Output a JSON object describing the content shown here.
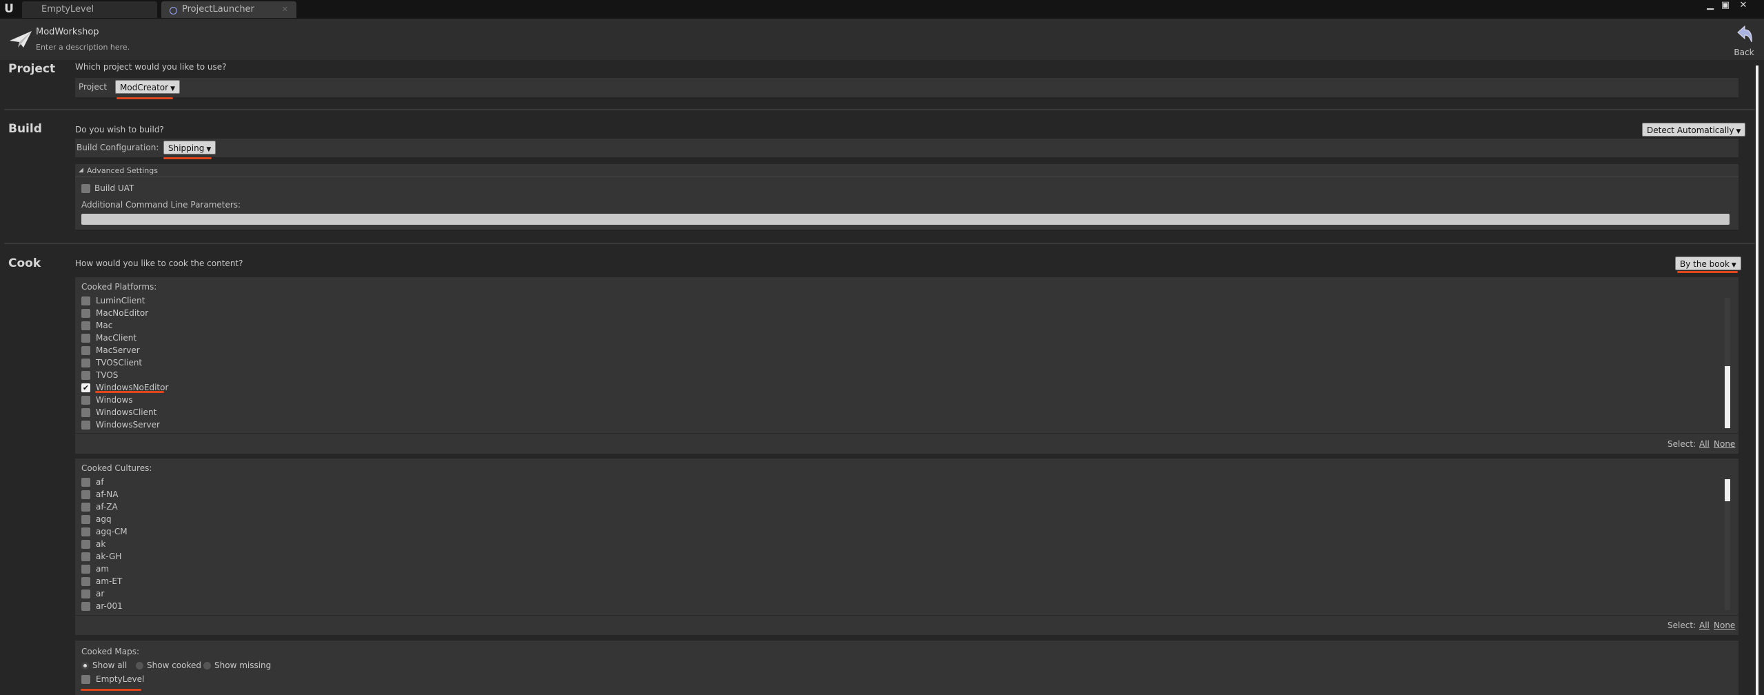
{
  "tabs": [
    {
      "label": "EmptyLevel"
    },
    {
      "label": "ProjectLauncher"
    }
  ],
  "header": {
    "title": "ModWorkshop",
    "description": "Enter a description here.",
    "back_label": "Back"
  },
  "project": {
    "section_title": "Project",
    "question": "Which project would you like to use?",
    "label": "Project",
    "value": "ModCreator"
  },
  "build": {
    "section_title": "Build",
    "question": "Do you wish to build?",
    "mode": "Detect Automatically",
    "config_label": "Build Configuration:",
    "config_value": "Shipping",
    "advanced_label": "Advanced Settings",
    "build_uat_label": "Build UAT",
    "cmdline_label": "Additional Command Line Parameters:",
    "cmdline_value": ""
  },
  "cook": {
    "section_title": "Cook",
    "question": "How would you like to cook the content?",
    "mode": "By the book",
    "platforms_label": "Cooked Platforms:",
    "platforms": [
      {
        "label": "LuminClient",
        "checked": false
      },
      {
        "label": "MacNoEditor",
        "checked": false
      },
      {
        "label": "Mac",
        "checked": false
      },
      {
        "label": "MacClient",
        "checked": false
      },
      {
        "label": "MacServer",
        "checked": false
      },
      {
        "label": "TVOSClient",
        "checked": false
      },
      {
        "label": "TVOS",
        "checked": false
      },
      {
        "label": "WindowsNoEditor",
        "checked": true
      },
      {
        "label": "Windows",
        "checked": false
      },
      {
        "label": "WindowsClient",
        "checked": false
      },
      {
        "label": "WindowsServer",
        "checked": false
      }
    ],
    "cultures_label": "Cooked Cultures:",
    "cultures": [
      {
        "label": "af",
        "checked": false
      },
      {
        "label": "af-NA",
        "checked": false
      },
      {
        "label": "af-ZA",
        "checked": false
      },
      {
        "label": "agq",
        "checked": false
      },
      {
        "label": "agq-CM",
        "checked": false
      },
      {
        "label": "ak",
        "checked": false
      },
      {
        "label": "ak-GH",
        "checked": false
      },
      {
        "label": "am",
        "checked": false
      },
      {
        "label": "am-ET",
        "checked": false
      },
      {
        "label": "ar",
        "checked": false
      },
      {
        "label": "ar-001",
        "checked": false
      }
    ],
    "select_label": "Select:",
    "select_all": "All",
    "select_none": "None",
    "maps_label": "Cooked Maps:",
    "map_filters": [
      {
        "label": "Show all",
        "selected": true
      },
      {
        "label": "Show cooked",
        "selected": false
      },
      {
        "label": "Show missing",
        "selected": false
      }
    ],
    "maps": [
      {
        "label": "EmptyLevel",
        "checked": false
      }
    ]
  }
}
